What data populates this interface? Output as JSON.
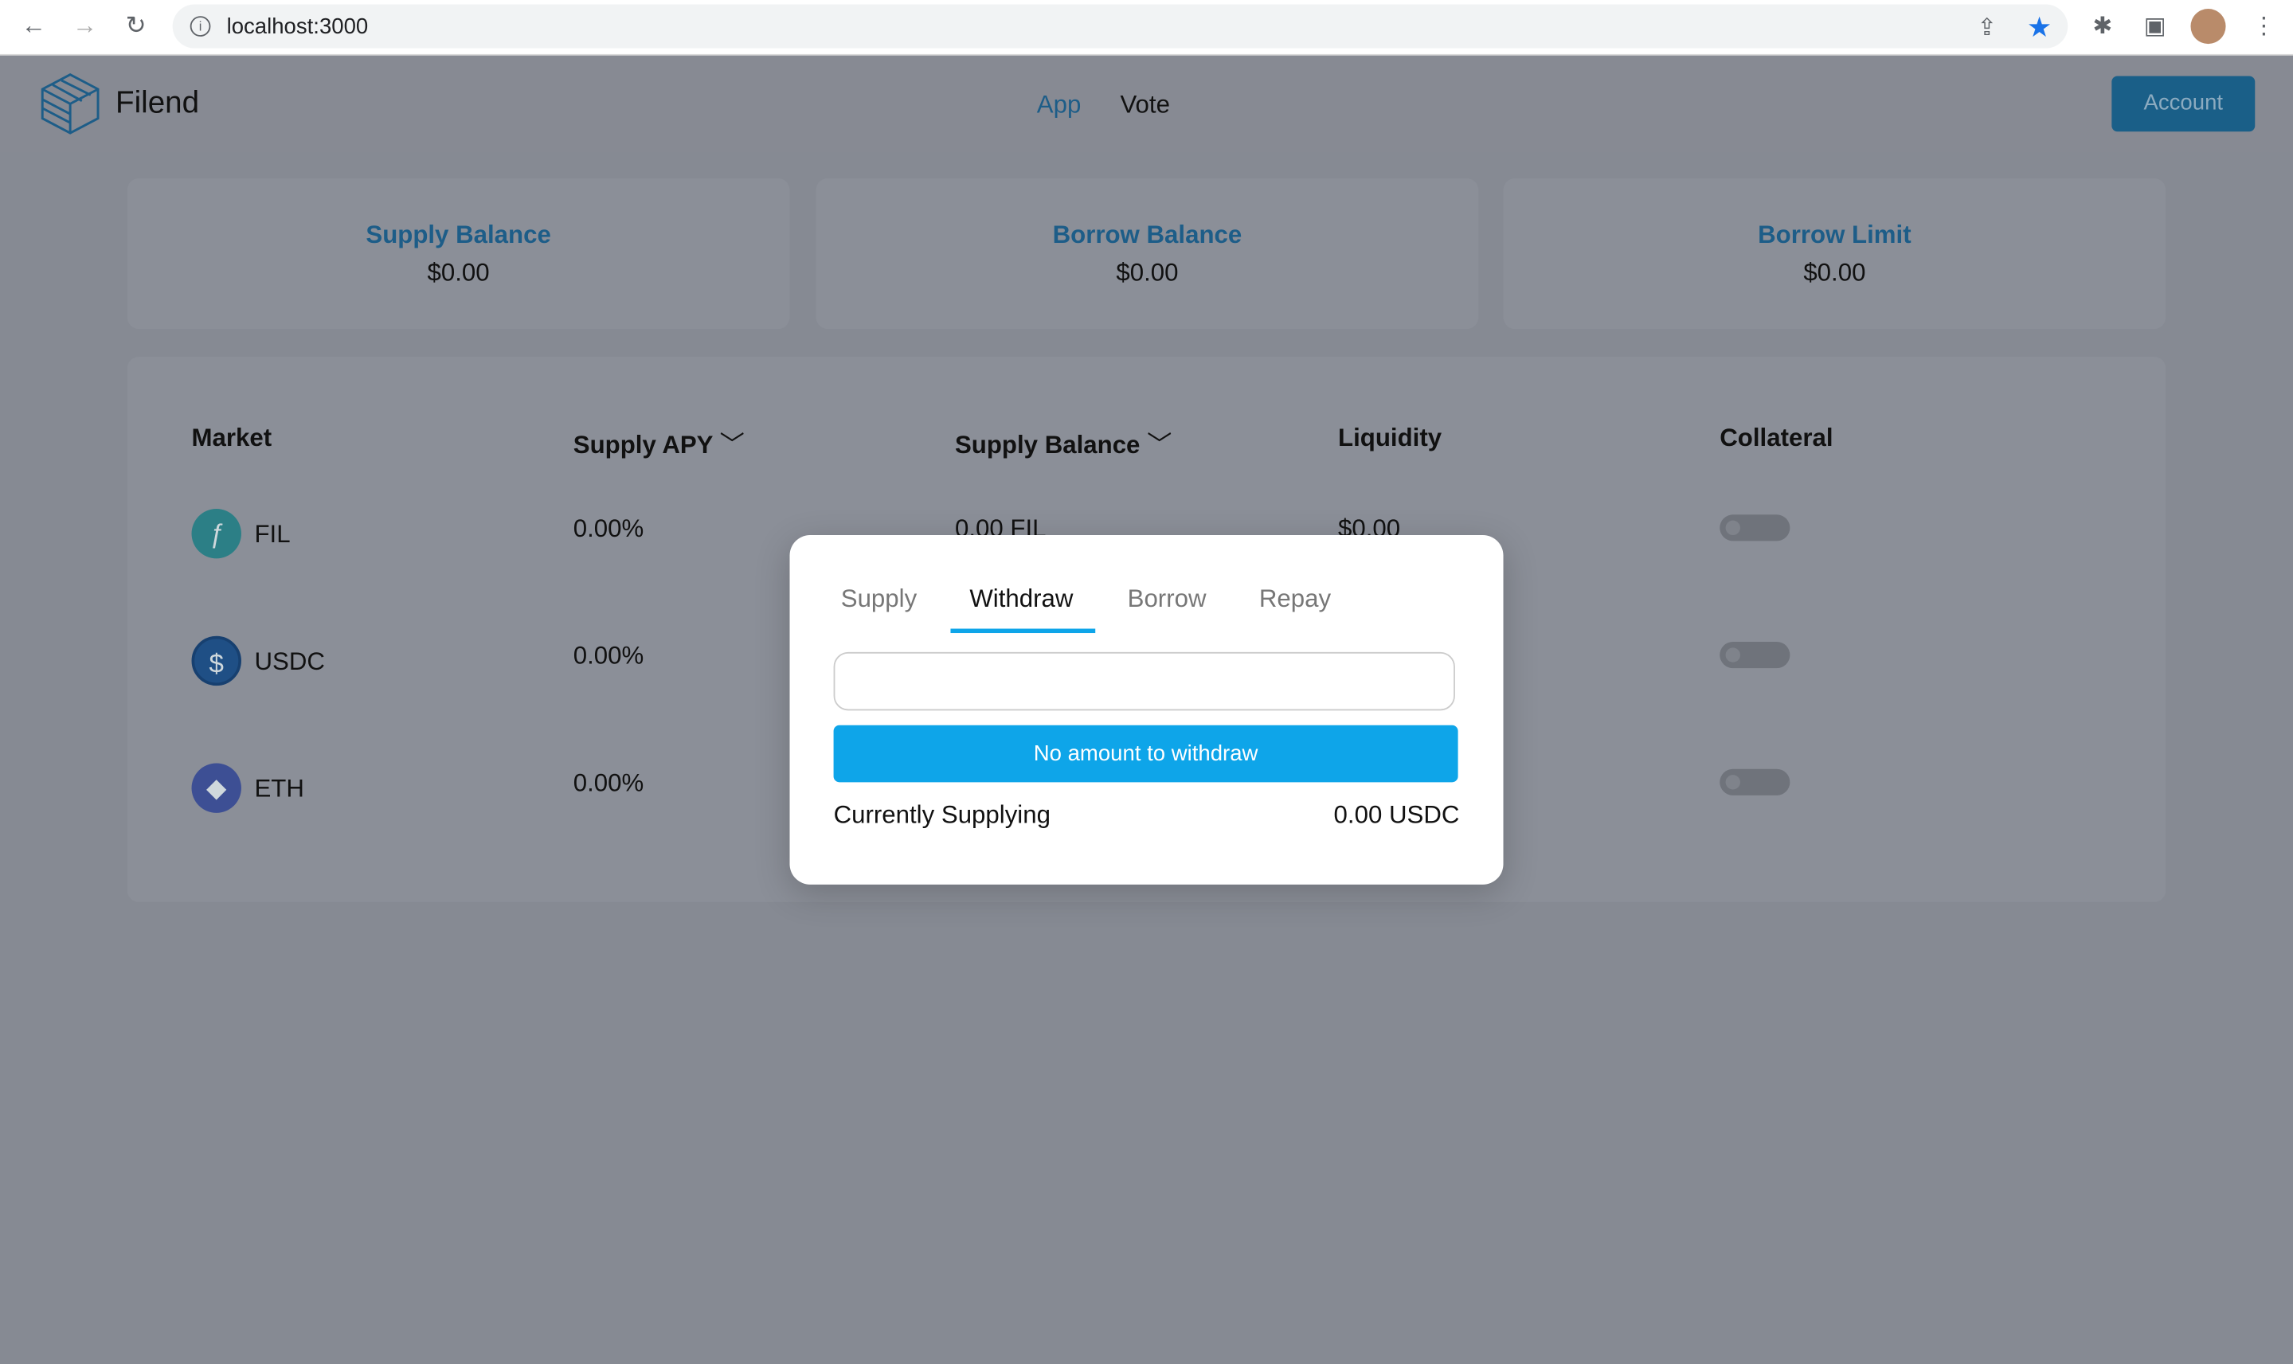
{
  "browser": {
    "url": "localhost:3000"
  },
  "header": {
    "brand": "Filend",
    "nav": [
      {
        "label": "App",
        "active": true
      },
      {
        "label": "Vote",
        "active": false
      }
    ],
    "account_label": "Account"
  },
  "summary": [
    {
      "title": "Supply Balance",
      "value": "$0.00"
    },
    {
      "title": "Borrow Balance",
      "value": "$0.00"
    },
    {
      "title": "Borrow Limit",
      "value": "$0.00"
    }
  ],
  "table": {
    "headers": [
      "Market",
      "Supply APY",
      "Supply Balance",
      "Liquidity",
      "Collateral"
    ],
    "rows": [
      {
        "market": "FIL",
        "apy": "0.00%",
        "balance": "0.00 FIL",
        "liquidity": "$0.00",
        "collateral": false
      },
      {
        "market": "USDC",
        "apy": "0.00%",
        "collateral": false
      },
      {
        "market": "ETH",
        "apy": "0.00%",
        "collateral": false
      }
    ]
  },
  "modal": {
    "tabs": [
      "Supply",
      "Withdraw",
      "Borrow",
      "Repay"
    ],
    "active_tab": "Withdraw",
    "amount_value": "",
    "button_label": "No amount to withdraw",
    "info_label": "Currently Supplying",
    "info_value": "0.00 USDC"
  },
  "colors": {
    "accent": "#0ea5e9",
    "brand": "#1d5d88",
    "overlay": "#868a93"
  }
}
